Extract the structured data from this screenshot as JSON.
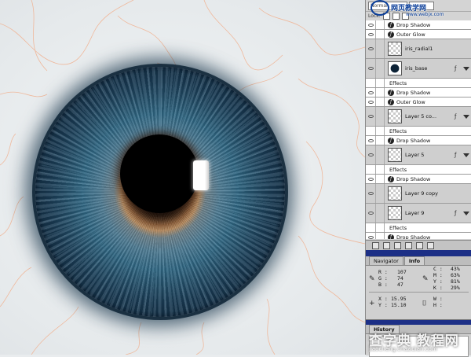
{
  "layers_panel": {
    "blend_mode": "Normal",
    "lock_label": "Lock:",
    "rows": [
      {
        "kind": "effect",
        "label": "Drop Shadow"
      },
      {
        "kind": "effect",
        "label": "Outer Glow"
      },
      {
        "kind": "layer",
        "label": "iris_radial1",
        "thumb": "transparent",
        "has_fx": false
      },
      {
        "kind": "layer",
        "label": "iris_base",
        "thumb": "iris",
        "has_fx": true
      },
      {
        "kind": "effects",
        "label": "Effects"
      },
      {
        "kind": "effect",
        "label": "Drop Shadow"
      },
      {
        "kind": "effect",
        "label": "Outer Glow"
      },
      {
        "kind": "layer",
        "label": "Layer 5 co...",
        "thumb": "transparent",
        "has_fx": true
      },
      {
        "kind": "effects",
        "label": "Effects"
      },
      {
        "kind": "effect",
        "label": "Drop Shadow"
      },
      {
        "kind": "layer",
        "label": "Layer 5",
        "thumb": "transparent",
        "has_fx": true
      },
      {
        "kind": "effects",
        "label": "Effects"
      },
      {
        "kind": "effect",
        "label": "Drop Shadow"
      },
      {
        "kind": "layer",
        "label": "Layer 9 copy",
        "thumb": "transparent",
        "has_fx": false
      },
      {
        "kind": "layer",
        "label": "Layer 9",
        "thumb": "transparent",
        "has_fx": true
      },
      {
        "kind": "effects",
        "label": "Effects"
      },
      {
        "kind": "effect",
        "label": "Drop Shadow"
      }
    ]
  },
  "info_panel": {
    "tabs": [
      "Navigator",
      "Info"
    ],
    "active_tab": "Info",
    "rgb": {
      "r_label": "R :",
      "r": "107",
      "g_label": "G :",
      "g": "74",
      "b_label": "B :",
      "b": "47"
    },
    "cmyk": {
      "c_label": "C :",
      "c": "43%",
      "m_label": "M :",
      "m": "63%",
      "y_label": "Y :",
      "y": "81%",
      "k_label": "K :",
      "k": "29%"
    },
    "coords": {
      "x_label": "X :",
      "x": "15.95",
      "y_label": "Y :",
      "y": "15.10"
    },
    "size": {
      "w_label": "W :",
      "h_label": "H :"
    }
  },
  "history_panel": {
    "tabs": [
      "History"
    ]
  },
  "watermark": {
    "top_text": "网页教学网",
    "top_url": "www.webjx.com",
    "bottom_text": "查字典 教程网",
    "bottom_url": "jiaocheng.chazidian.com"
  },
  "colors": {
    "iris_dark": "#0c2236",
    "iris_mid": "#2f6682",
    "iris_amber": "#b88a5c",
    "titlebar": "#1c2f86"
  }
}
